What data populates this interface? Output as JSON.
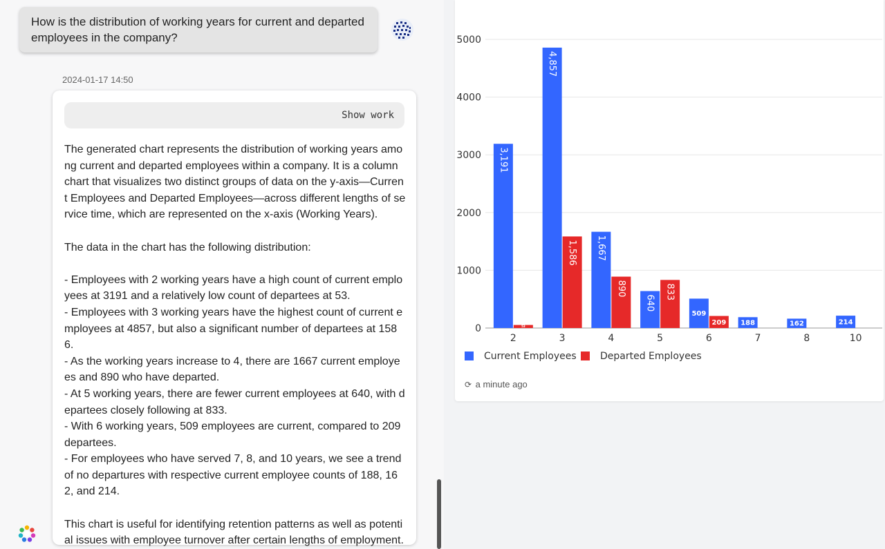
{
  "conversation": {
    "question": "How is the distribution of working years for current and departed employees in the company?",
    "timestamp": "2024-01-17 14:50",
    "show_work_label": "Show work",
    "answer_paragraphs": [
      "The generated chart represents the distribution of working years among current and departed employees within a company. It is a column chart that visualizes two distinct groups of data on the y-axis—Current Employees and Departed Employees—across different lengths of service time, which are represented on the x-axis (Working Years).",
      "",
      "The data in the chart has the following distribution:",
      "",
      "- Employees with 2 working years have a high count of current employees at 3191 and a relatively low count of departees at 53.",
      "- Employees with 3 working years have the highest count of current employees at 4857, but also a significant number of departees at 1586.",
      "- As the working years increase to 4, there are 1667 current employees and 890 who have departed.",
      "- At 5 working years, there are fewer current employees at 640, with departees closely following at 833.",
      "- With 6 working years, 509 employees are current, compared to 209 departees.",
      "- For employees who have served 7, 8, and 10 years, we see a trend of no departures with respective current employee counts of 188, 162, and 214.",
      "",
      "This chart is useful for identifying retention patterns as well as potential issues with employee turnover after certain lengths of employment."
    ]
  },
  "chart_panel": {
    "updated_label": "a minute ago",
    "icons": {
      "refresh": "refresh-icon",
      "user": "user-avatar-icon",
      "bot": "bot-logo-icon"
    }
  },
  "chart_data": {
    "type": "bar",
    "categories": [
      "2",
      "3",
      "4",
      "5",
      "6",
      "7",
      "8",
      "10"
    ],
    "series": [
      {
        "name": "Current Employees",
        "color": "#3366ff",
        "values": [
          3191,
          4857,
          1667,
          640,
          509,
          188,
          162,
          214
        ],
        "labels": [
          "3,191",
          "4,857",
          "1,667",
          "640",
          "509",
          "188",
          "162",
          "214"
        ]
      },
      {
        "name": "Departed Employees",
        "color": "#e62929",
        "values": [
          53,
          1586,
          890,
          833,
          209,
          0,
          0,
          0
        ],
        "labels": [
          "53",
          "1,586",
          "890",
          "833",
          "209",
          "",
          "",
          ""
        ]
      }
    ],
    "yticks": [
      "0",
      "1000",
      "2000",
      "3000",
      "4000",
      "5000"
    ],
    "ylim": [
      0,
      5000
    ],
    "grid": true,
    "legend_position": "bottom-left"
  }
}
